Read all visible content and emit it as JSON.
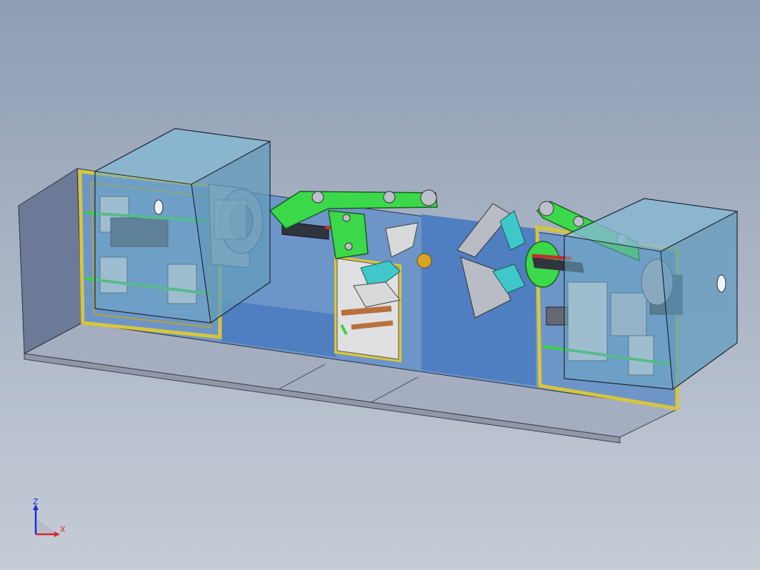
{
  "viewport": {
    "background_top": "#8f9cb4",
    "background_bottom": "#c5ccd6"
  },
  "colors": {
    "frame_yellow": "#e3d23a",
    "housing_blue": "#5b8fd2",
    "glass_cyan": "#7ab8d6",
    "arm_green": "#3bd84a",
    "bracket_cyan": "#3fc7c9",
    "base_gray": "#a7b0c2"
  },
  "triad": {
    "z_label": "Z",
    "x_label": "X"
  }
}
